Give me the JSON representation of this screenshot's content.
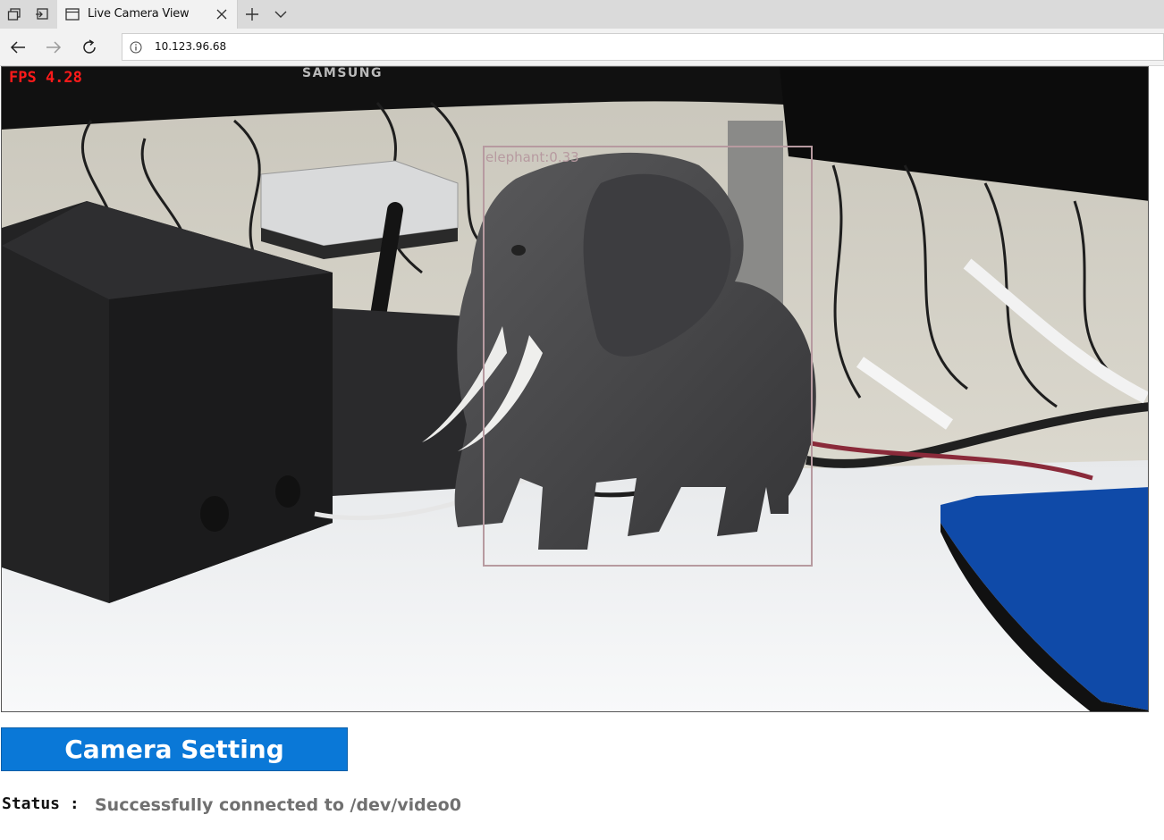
{
  "browser": {
    "tab_title": "Live Camera View",
    "url": "10.123.96.68"
  },
  "camera": {
    "fps_text": "FPS 4.28",
    "brand_text": "SAMSUNG",
    "detection": {
      "label": "elephant:0.33",
      "class": "elephant",
      "score": 0.33
    }
  },
  "controls": {
    "camera_setting_label": "Camera Setting"
  },
  "status": {
    "label": "Status :",
    "message": "Successfully connected to /dev/video0"
  },
  "colors": {
    "button_blue": "#0a78d7",
    "fps_red": "#ff1a1a",
    "bbox": "#b79aa0",
    "status_gray": "#707070"
  },
  "icons": [
    "tab-manager-icon",
    "tab-aside-icon",
    "page-icon",
    "close-icon",
    "plus-icon",
    "chevron-down-icon",
    "back-arrow-icon",
    "forward-arrow-icon",
    "refresh-icon",
    "info-icon"
  ]
}
